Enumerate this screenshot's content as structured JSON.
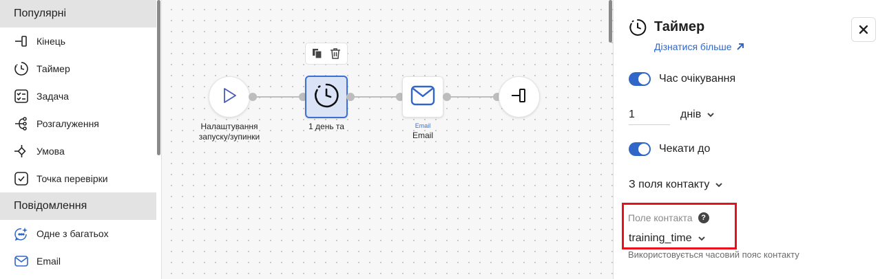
{
  "palette": {
    "section_popular": "Популярні",
    "popular_items": [
      {
        "label": "Кінець",
        "icon": "end-icon"
      },
      {
        "label": "Таймер",
        "icon": "timer-icon"
      },
      {
        "label": "Задача",
        "icon": "task-icon"
      },
      {
        "label": "Розгалуження",
        "icon": "branch-icon"
      },
      {
        "label": "Умова",
        "icon": "condition-icon"
      },
      {
        "label": "Точка перевірки",
        "icon": "checkpoint-icon"
      }
    ],
    "section_messages": "Повідомлення",
    "message_items": [
      {
        "label": "Одне з багатьох",
        "icon": "sparkle-chat-icon"
      },
      {
        "label": "Email",
        "icon": "email-icon"
      }
    ]
  },
  "canvas": {
    "nodes": [
      {
        "label": "Налаштування запуску/зупинки",
        "icon": "play-icon"
      },
      {
        "label": "1 день та",
        "icon": "timer-icon"
      },
      {
        "sublabel": "Email",
        "label": "Email",
        "icon": "email-icon"
      },
      {
        "icon": "end-icon"
      }
    ],
    "toolbar": {
      "copy_icon": "copy-icon",
      "delete_icon": "trash-icon"
    }
  },
  "panel": {
    "title": "Таймер",
    "learn_more": "Дізнатися більше",
    "wait_time_label": "Час очікування",
    "wait_time_enabled": true,
    "duration_value": "1",
    "duration_unit": "днів",
    "wait_until_label": "Чекати до",
    "wait_until_enabled": true,
    "source_select": "З поля контакту",
    "contact_field_label": "Поле контакта",
    "contact_field_value": "training_time",
    "hint": "Використовується часовий пояс контакту",
    "accent_color": "#2f66c8",
    "highlight_color": "#e8101a"
  }
}
